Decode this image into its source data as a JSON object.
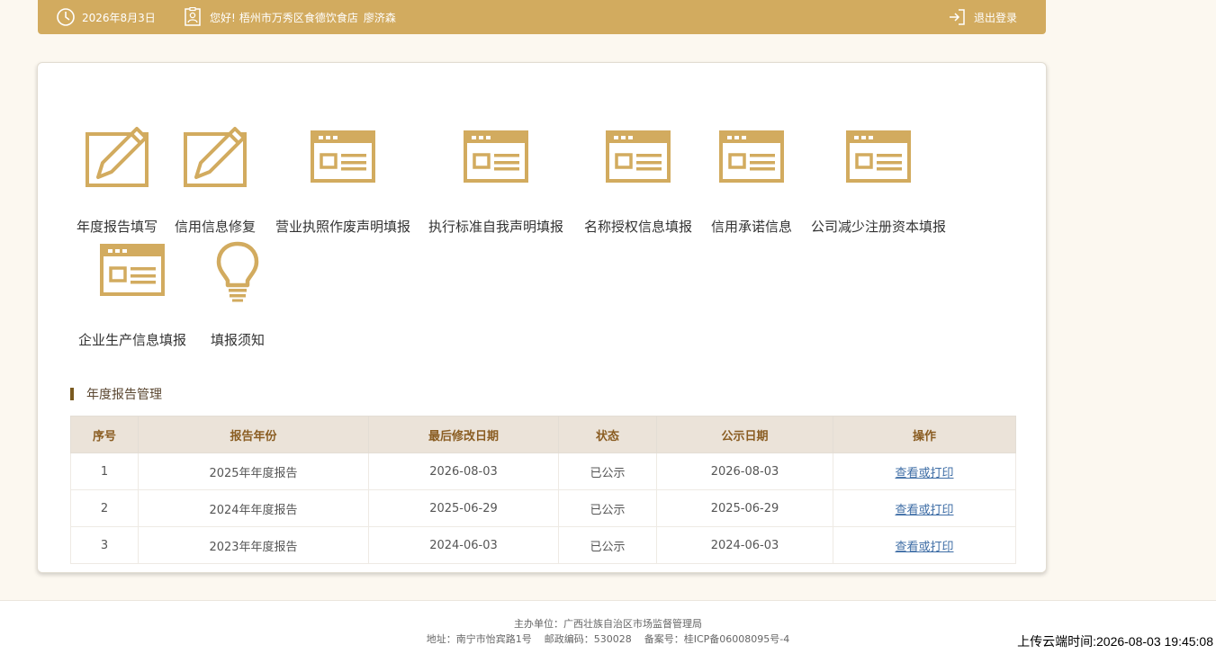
{
  "header": {
    "date": "2026年8月3日",
    "greeting": "您好!",
    "company": "梧州市万秀区食德饮食店",
    "person": "廖济森",
    "logout_label": "退出登录"
  },
  "menu": [
    {
      "label": "年度报告填写",
      "icon": "edit-pencil-icon"
    },
    {
      "label": "信用信息修复",
      "icon": "edit-pencil-icon"
    },
    {
      "label": "营业执照作废声明填报",
      "icon": "form-document-icon"
    },
    {
      "label": "执行标准自我声明填报",
      "icon": "form-document-icon"
    },
    {
      "label": "名称授权信息填报",
      "icon": "form-document-icon"
    },
    {
      "label": "信用承诺信息",
      "icon": "form-document-icon"
    },
    {
      "label": "公司减少注册资本填报",
      "icon": "form-document-icon"
    },
    {
      "label": "企业生产信息填报",
      "icon": "form-document-icon"
    },
    {
      "label": "填报须知",
      "icon": "lightbulb-icon"
    }
  ],
  "section": {
    "title": "年度报告管理"
  },
  "table": {
    "headers": [
      "序号",
      "报告年份",
      "最后修改日期",
      "状态",
      "公示日期",
      "操作"
    ],
    "rows": [
      [
        "1",
        "2025年年度报告",
        "2026-08-03",
        "已公示",
        "2026-08-03",
        "查看或打印"
      ],
      [
        "2",
        "2024年年度报告",
        "2025-06-29",
        "已公示",
        "2025-06-29",
        "查看或打印"
      ],
      [
        "3",
        "2023年年度报告",
        "2024-06-03",
        "已公示",
        "2024-06-03",
        "查看或打印"
      ]
    ]
  },
  "footer": {
    "sponsor": "主办单位：广西壮族自治区市场监督管理局",
    "address": "地址：南宁市怡宾路1号",
    "postcode": "邮政编码：530028",
    "icp": "备案号：桂ICP备06008095号-4"
  },
  "upload_time": "上传云端时间:2026-08-03 19:45:08",
  "colors": {
    "accent": "#d2ab5f",
    "link": "#3f6ea6",
    "table_header_bg": "#ebe3d9"
  }
}
